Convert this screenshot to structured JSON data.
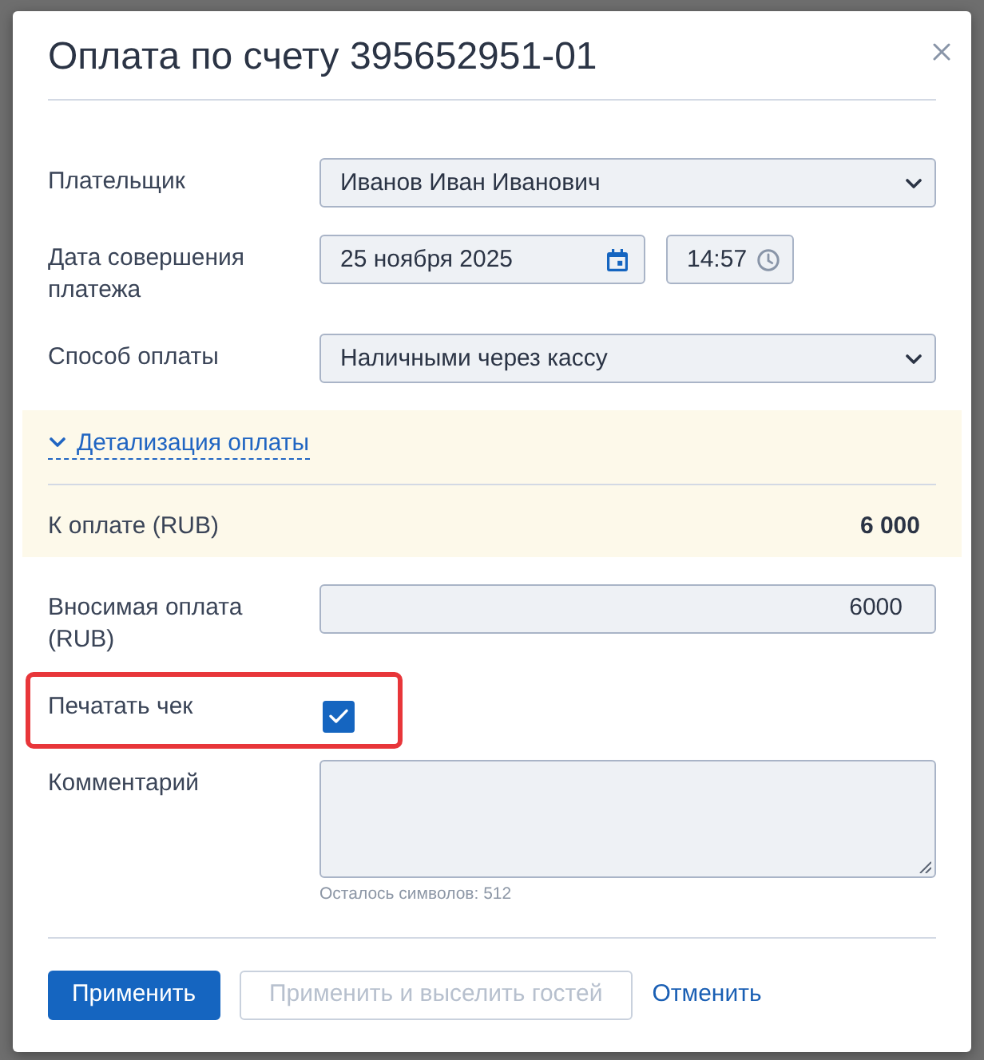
{
  "dialog": {
    "title": "Оплата по счету 395652951-01"
  },
  "rows": [
    {
      "kind": "select",
      "label": "Плательщик",
      "value": "Иванов Иван Иванович"
    },
    {
      "kind": "datetime",
      "label": "Дата совершения платежа",
      "date": "25 ноября 2025",
      "time": "14:57"
    },
    {
      "kind": "select",
      "label": "Способ оплаты",
      "value": "Наличными через кассу"
    },
    {
      "kind": "details",
      "toggle": "Детализация оплаты",
      "label": "К оплате (RUB)",
      "value": "6 000"
    },
    {
      "kind": "amount",
      "label": "Вносимая оплата (RUB)",
      "value": "6000"
    },
    {
      "kind": "checkbox",
      "label": "Печатать чек",
      "checked": true,
      "highlighted": true
    },
    {
      "kind": "textarea",
      "label": "Комментарий",
      "hint": "Осталось символов: 512"
    }
  ],
  "buttons": [
    {
      "kind": "primary",
      "label": "Применить",
      "disabled": false
    },
    {
      "kind": "outline",
      "label": "Применить и выселить гостей",
      "disabled": true
    },
    {
      "kind": "link",
      "label": "Отменить",
      "disabled": false
    }
  ]
}
